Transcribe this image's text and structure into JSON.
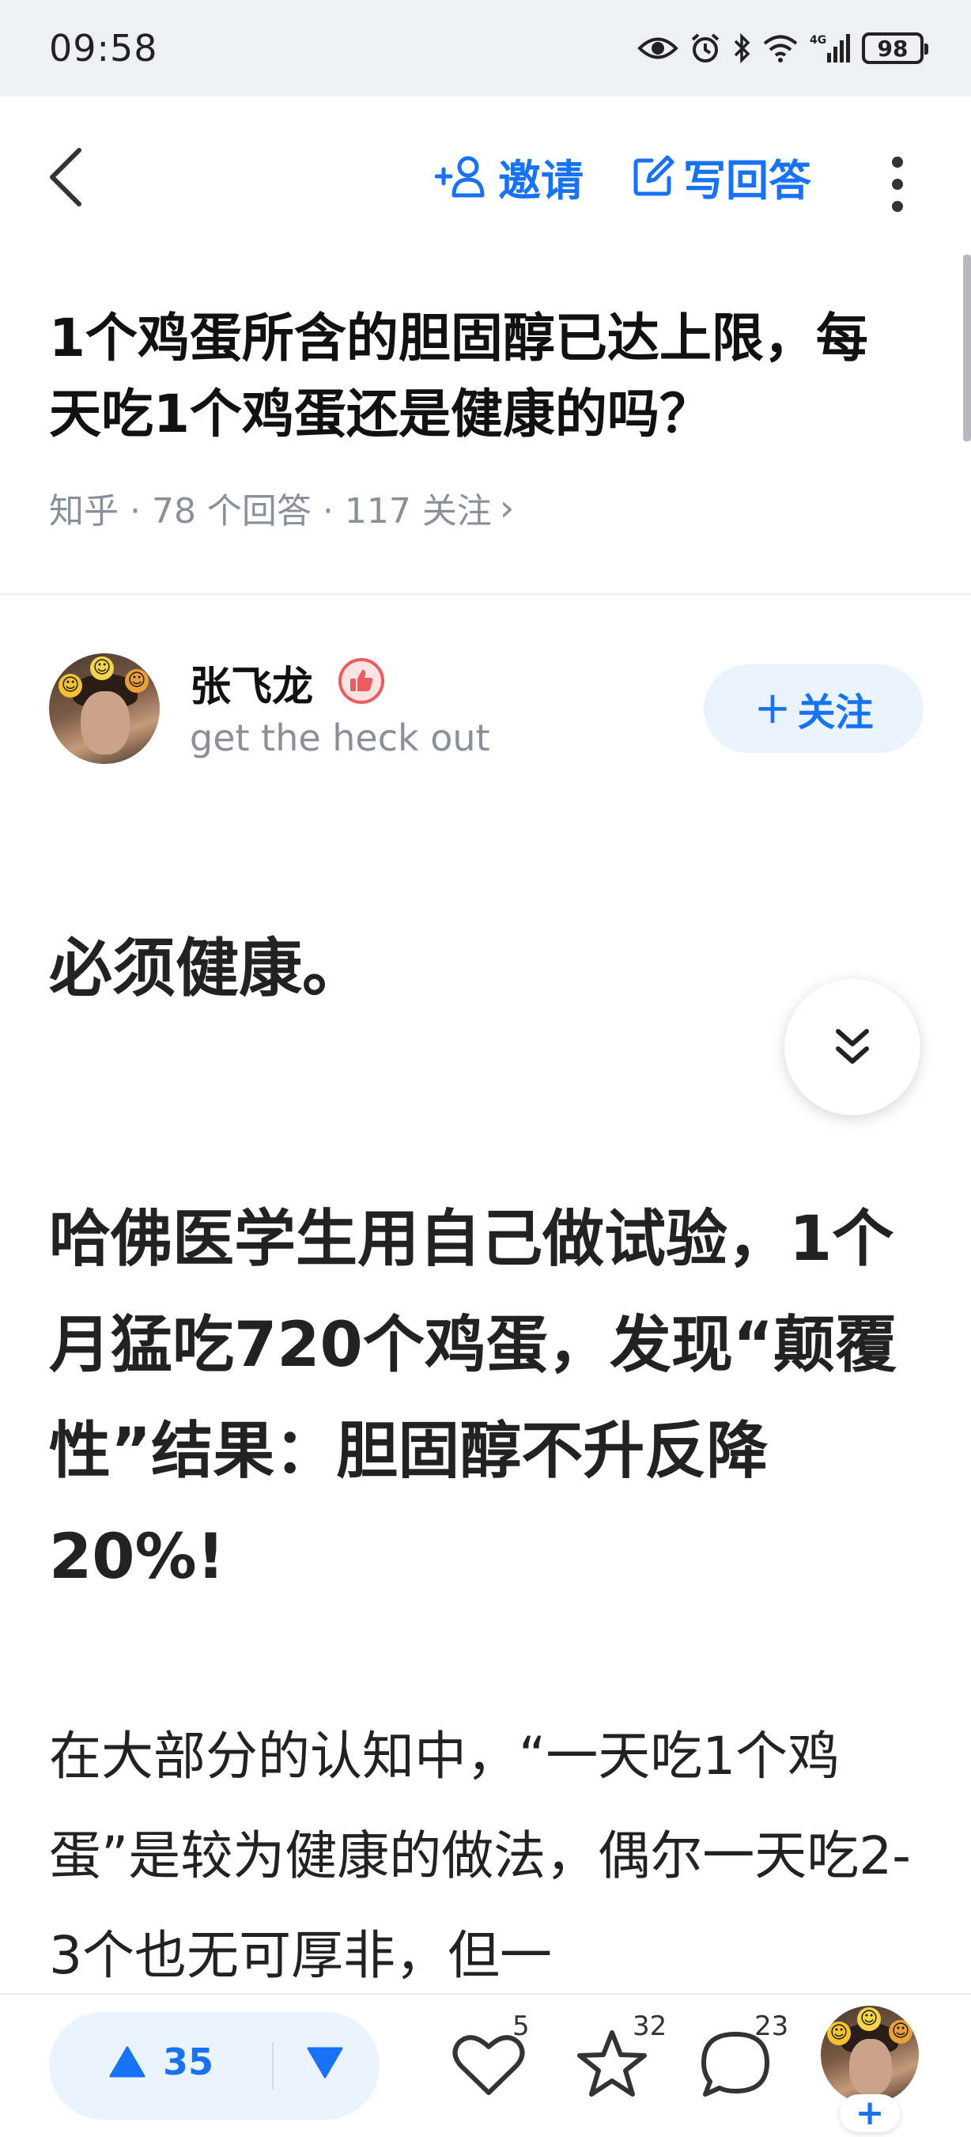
{
  "status_bar": {
    "time": "09:58",
    "network": "4G",
    "battery": "98",
    "icons": [
      "eye-icon",
      "alarm-icon",
      "bluetooth-icon",
      "wifi-icon",
      "signal-icon",
      "battery-icon"
    ]
  },
  "nav": {
    "back_icon": "chevron-left-icon",
    "invite_label": "邀请",
    "write_answer_label": "写回答",
    "more_icon": "more-vertical-icon"
  },
  "question": {
    "title": "1个鸡蛋所含的胆固醇已达上限，每天吃1个鸡蛋还是健康的吗？",
    "meta": "知乎 · 78 个回答 · 117 关注",
    "meta_chevron": "›"
  },
  "author": {
    "name": "张飞龙",
    "bio": "get the heck out",
    "follow_label": "关注",
    "badge_icon": "thumbs-up-badge-icon"
  },
  "answer": {
    "lead": "必须健康。",
    "headline": "哈佛医学生用自己做试验，1个月猛吃720个鸡蛋，发现“颠覆性”结果：胆固醇不升反降20%!",
    "body": "在大部分的认知中，“一天吃1个鸡蛋”是较为健康的做法，偶尔一天吃2-3个也无可厚非，但一"
  },
  "bottom_bar": {
    "upvote_count": "35",
    "like_count": "5",
    "favorite_count": "32",
    "comment_count": "23",
    "plus_label": "+"
  },
  "colors": {
    "accent": "#1772f6",
    "accent_bg": "#ebf3ff",
    "meta_gray": "#8a8f99",
    "status_bg": "#eef0f3",
    "badge_red": "#ea5c62"
  }
}
